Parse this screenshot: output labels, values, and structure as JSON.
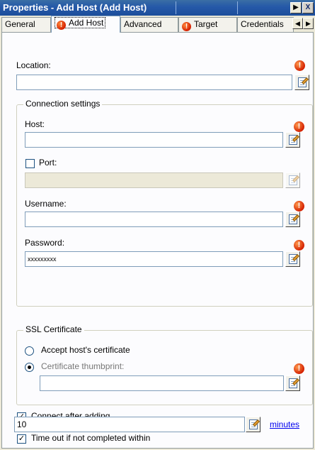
{
  "window": {
    "title": "Properties - Add Host (Add Host)",
    "menu_arrow": "▶",
    "close": "X"
  },
  "tabs": [
    {
      "label": "General"
    },
    {
      "label": "Add Host",
      "warning": true
    },
    {
      "label": "Advanced"
    },
    {
      "label": "Target",
      "warning": true
    },
    {
      "label": "Credentials"
    }
  ],
  "tab_scroll": {
    "left": "◀",
    "right": "▶"
  },
  "form": {
    "location": {
      "label": "Location:",
      "value": ""
    },
    "connection_group": "Connection settings",
    "host": {
      "label": "Host:",
      "value": ""
    },
    "port": {
      "label": "Port:",
      "checked": false,
      "value": ""
    },
    "username": {
      "label": "Username:",
      "value": ""
    },
    "password": {
      "label": "Password:",
      "value": "xxxxxxxxx"
    },
    "ssl_group": "SSL Certificate",
    "accept_host_cert": {
      "label": "Accept host's certificate",
      "selected": false
    },
    "cert_thumbprint": {
      "label": "Certificate thumbprint:",
      "selected": true,
      "value": ""
    },
    "connect_after": {
      "label": "Connect after adding",
      "checked": true
    },
    "timeout": {
      "label": "Time out if not completed within",
      "checked": true,
      "value": "10",
      "unit_link": "minutes"
    }
  },
  "icons": {
    "warning": "!",
    "check": "✓"
  }
}
